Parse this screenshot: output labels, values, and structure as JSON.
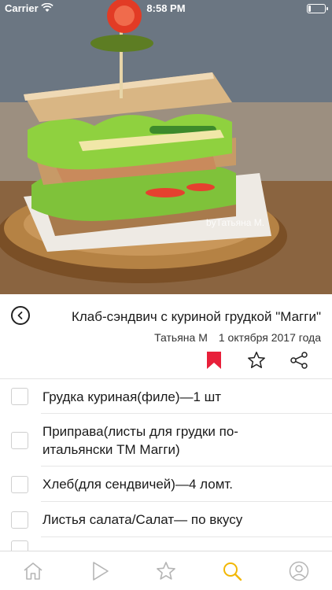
{
  "status_bar": {
    "carrier": "Carrier",
    "time": "8:58 PM",
    "battery_level": 0.15
  },
  "hero": {
    "watermark": "byТатьяна М.",
    "description_icon": "sandwich-photo"
  },
  "recipe": {
    "title": "Клаб-сэндвич с куриной грудкой \"Магги\"",
    "author": "Татьяна М",
    "date": "1 октября 2017 года"
  },
  "actions": {
    "bookmark_icon": "bookmark-icon",
    "favorite_icon": "star-icon",
    "share_icon": "share-icon",
    "bookmark_color": "#e8203a"
  },
  "ingredients": [
    {
      "text": "Грудка куриная(филе)—1 шт",
      "checked": false
    },
    {
      "text": "Приправа(листы для грудки по-итальянски ТМ Магги)",
      "checked": false
    },
    {
      "text": "Хлеб(для сендвичей)—4 ломт.",
      "checked": false
    },
    {
      "text": "Листья салата/Салат— по вкусу",
      "checked": false
    }
  ],
  "tabbar": {
    "items": [
      {
        "icon": "home-icon",
        "active": false
      },
      {
        "icon": "play-icon",
        "active": false
      },
      {
        "icon": "star-icon",
        "active": false
      },
      {
        "icon": "search-icon",
        "active": true
      },
      {
        "icon": "profile-icon",
        "active": false
      }
    ],
    "active_color": "#f2b705",
    "inactive_color": "#b5b5b5"
  }
}
